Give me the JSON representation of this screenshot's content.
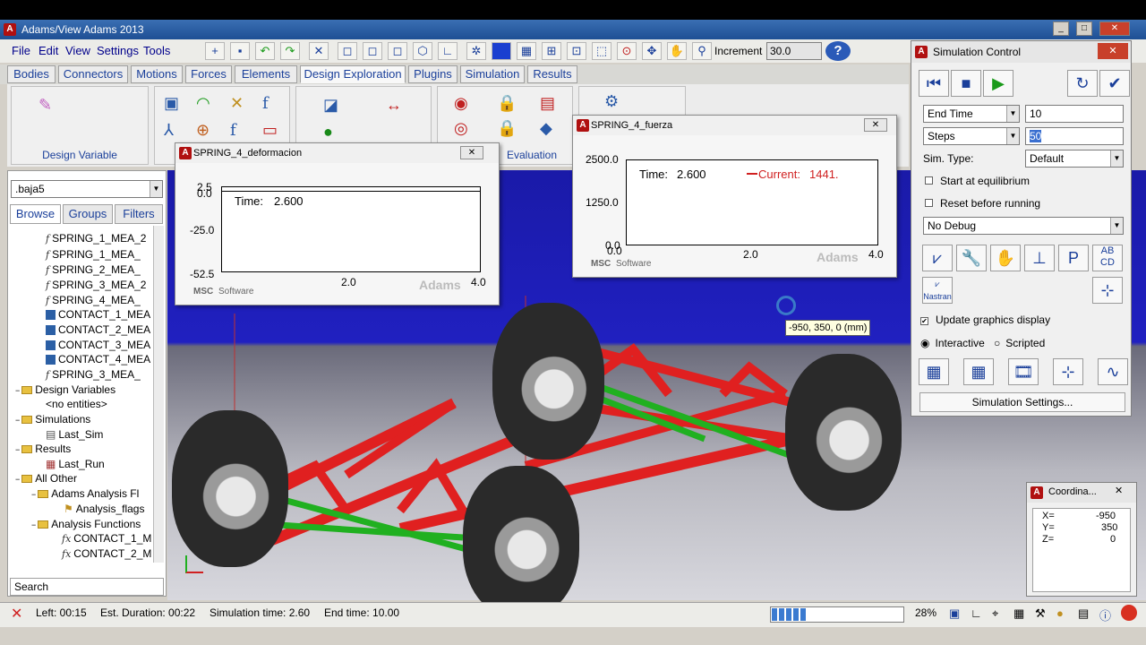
{
  "window": {
    "title": "Adams/View Adams 2013"
  },
  "menu": [
    "File",
    "Edit",
    "View",
    "Settings",
    "Tools"
  ],
  "toolbar": {
    "increment_label": "Increment",
    "increment_value": "30.0"
  },
  "tabs": [
    "Bodies",
    "Connectors",
    "Motions",
    "Forces",
    "Elements",
    "Design Exploration",
    "Plugins",
    "Simulation",
    "Results"
  ],
  "ribbon": {
    "design_variable": "Design Variable",
    "evaluation": "Evaluation"
  },
  "browser": {
    "model": ".baja5",
    "tabs": [
      "Browse",
      "Groups",
      "Filters"
    ],
    "search": "Search",
    "tree": [
      "SPRING_1_MEA_2",
      "SPRING_1_MEA_",
      "SPRING_2_MEA_",
      "SPRING_3_MEA_2",
      "SPRING_4_MEA_",
      "CONTACT_1_MEA",
      "CONTACT_2_MEA",
      "CONTACT_3_MEA",
      "CONTACT_4_MEA",
      "SPRING_3_MEA_",
      "Design Variables",
      "<no entities>",
      "Simulations",
      "Last_Sim",
      "Results",
      "Last_Run",
      "All Other",
      "Adams Analysis Fl",
      "Analysis_flags",
      "Analysis Functions",
      "CONTACT_1_M",
      "CONTACT_2_M"
    ]
  },
  "plot1": {
    "title": "SPRING_4_deformacion",
    "time_label": "Time:",
    "time_value": "2.600",
    "y_ticks": [
      "2.5",
      "0.0",
      "-25.0",
      "-52.5"
    ],
    "x_ticks": [
      "2.0",
      "4.0"
    ],
    "msc": "MSC",
    "software": "Software",
    "adams": "Adams"
  },
  "plot2": {
    "title": "SPRING_4_fuerza",
    "time_label": "Time:",
    "time_value": "2.600",
    "current_label": "Current:",
    "current_value": "1441.",
    "y_ticks": [
      "2500.0",
      "1250.0",
      "0.0",
      "0.0"
    ],
    "x_ticks": [
      "2.0",
      "4.0"
    ],
    "msc": "MSC",
    "software": "Software",
    "adams": "Adams"
  },
  "tooltip": "-950, 350, 0 (mm)",
  "sim_control": {
    "title": "Simulation Control",
    "end_mode": "End Time",
    "end_value": "10",
    "steps_mode": "Steps",
    "steps_value": "50",
    "sim_type_label": "Sim. Type:",
    "sim_type": "Default",
    "start_eq": "Start at equilibrium",
    "reset": "Reset before running",
    "debug": "No Debug",
    "update_graphics": "Update graphics display",
    "interactive": "Interactive",
    "scripted": "Scripted",
    "settings_btn": "Simulation Settings...",
    "nastran": "Nastran"
  },
  "coord": {
    "title": "Coordina...",
    "x_label": "X=",
    "x": "-950",
    "y_label": "Y=",
    "y": "350",
    "z_label": "Z=",
    "z": "0"
  },
  "status": {
    "left": "Left: 00:15",
    "est": "Est. Duration: 00:22",
    "sim_time": "Simulation time: 2.60",
    "end_time": "End time: 10.00",
    "zoom": "28%"
  },
  "colors": {
    "accent": "#1a3f9a",
    "frame_red": "#d01818",
    "frame_green": "#2ab82a",
    "sky": "#2020c0"
  }
}
